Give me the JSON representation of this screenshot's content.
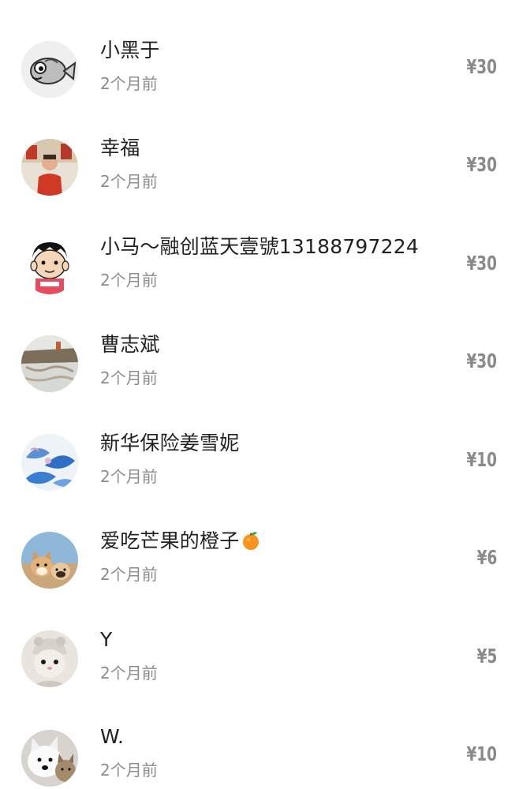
{
  "records": [
    {
      "name": "小黑于",
      "time": "2个月前",
      "amount": "¥30",
      "avatar": "sketch-fish-avatar"
    },
    {
      "name": "幸福",
      "time": "2个月前",
      "amount": "¥30",
      "avatar": "photo-person-red-avatar"
    },
    {
      "name": "小马～融创蓝天壹號13188797224",
      "time": "2个月前",
      "amount": "¥30",
      "avatar": "cartoon-boy-avatar"
    },
    {
      "name": "曹志斌",
      "time": "2个月前",
      "amount": "¥30",
      "avatar": "waterfall-landscape-avatar"
    },
    {
      "name": "新华保险姜雪妮",
      "time": "2个月前",
      "amount": "¥10",
      "avatar": "blue-flower-avatar"
    },
    {
      "name": "爱吃芒果的橙子",
      "time": "2个月前",
      "amount": "¥6",
      "avatar": "two-dogs-avatar",
      "emoji": "orange-emoji-icon"
    },
    {
      "name": "Y",
      "time": "2个月前",
      "amount": "¥5",
      "avatar": "cat-in-hat-avatar"
    },
    {
      "name": "W.",
      "time": "2个月前",
      "amount": "¥10",
      "avatar": "dog-and-cat-avatar"
    }
  ],
  "colors": {
    "name": "#222222",
    "time": "#8c8c8c",
    "amount": "#8a8a8a",
    "background": "#ffffff"
  }
}
